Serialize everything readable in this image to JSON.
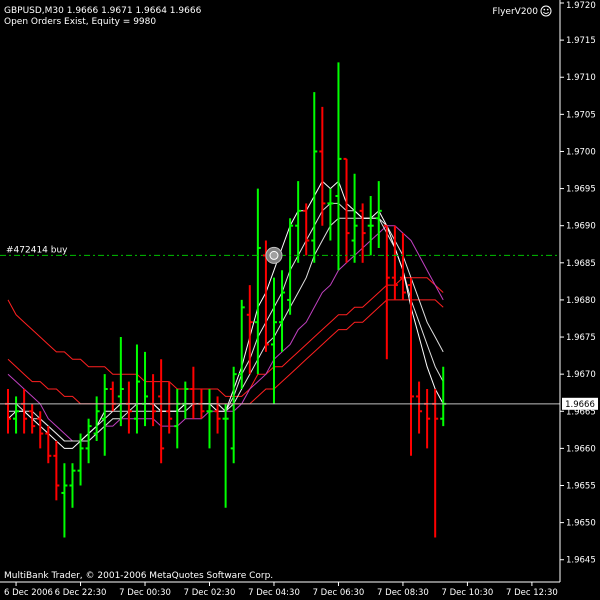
{
  "header": {
    "symbol_line": "GBPUSD,M30  1.9666 1.9671 1.9664 1.9666",
    "status_line": "Open Orders Exist, Equity = 9980",
    "indicator_name": "FlyerV200"
  },
  "footer": {
    "copyright": "MultiBank Trader, © 2001-2006 MetaQuotes Software Corp."
  },
  "order": {
    "label": "#472414 buy",
    "price": 1.9686,
    "color": "#00c000"
  },
  "current_price": {
    "label": "1.9666",
    "value": 1.9666
  },
  "colors": {
    "background": "#000000",
    "axis": "#ffffff",
    "bull_bar": "#00ff00",
    "bear_bar": "#ff0000",
    "ma_fast": "#ffffff",
    "ma_mid": "#e0e0e0",
    "ma_magenta": "#c040c0",
    "ma_red": "#ff2020"
  },
  "chart_data": {
    "type": "ohlc",
    "symbol": "GBPUSD",
    "timeframe": "M30",
    "ylim": [
      1.9642,
      1.972
    ],
    "y_ticks": [
      "1.9720",
      "1.9715",
      "1.9710",
      "1.9705",
      "1.9700",
      "1.9695",
      "1.9690",
      "1.9685",
      "1.9680",
      "1.9675",
      "1.9670",
      "1.9665",
      "1.9660",
      "1.9655",
      "1.9650",
      "1.9645"
    ],
    "x_ticks": [
      {
        "label": "6 Dec 2006",
        "bar": 1
      },
      {
        "label": "6 Dec 22:30",
        "bar": 9
      },
      {
        "label": "7 Dec 00:30",
        "bar": 17
      },
      {
        "label": "7 Dec 02:30",
        "bar": 25
      },
      {
        "label": "7 Dec 04:30",
        "bar": 33
      },
      {
        "label": "7 Dec 06:30",
        "bar": 41
      },
      {
        "label": "7 Dec 08:30",
        "bar": 49
      },
      {
        "label": "7 Dec 10:30",
        "bar": 57
      },
      {
        "label": "7 Dec 12:30",
        "bar": 65
      }
    ],
    "bars": [
      {
        "o": 1.9666,
        "h": 1.9668,
        "l": 1.9662,
        "c": 1.9664
      },
      {
        "o": 1.9664,
        "h": 1.9667,
        "l": 1.9662,
        "c": 1.9665
      },
      {
        "o": 1.9666,
        "h": 1.9668,
        "l": 1.9662,
        "c": 1.9664
      },
      {
        "o": 1.9665,
        "h": 1.9666,
        "l": 1.9662,
        "c": 1.9663
      },
      {
        "o": 1.9664,
        "h": 1.9665,
        "l": 1.966,
        "c": 1.9662
      },
      {
        "o": 1.9662,
        "h": 1.9663,
        "l": 1.9658,
        "c": 1.9659
      },
      {
        "o": 1.9659,
        "h": 1.9661,
        "l": 1.9653,
        "c": 1.9655
      },
      {
        "o": 1.9654,
        "h": 1.9658,
        "l": 1.9648,
        "c": 1.9655
      },
      {
        "o": 1.9655,
        "h": 1.9658,
        "l": 1.9652,
        "c": 1.9657
      },
      {
        "o": 1.9657,
        "h": 1.9662,
        "l": 1.9655,
        "c": 1.966
      },
      {
        "o": 1.966,
        "h": 1.9664,
        "l": 1.9658,
        "c": 1.9663
      },
      {
        "o": 1.9662,
        "h": 1.9667,
        "l": 1.9661,
        "c": 1.9665
      },
      {
        "o": 1.9664,
        "h": 1.967,
        "l": 1.9659,
        "c": 1.9668
      },
      {
        "o": 1.9668,
        "h": 1.9669,
        "l": 1.9665,
        "c": 1.9666
      },
      {
        "o": 1.9667,
        "h": 1.9675,
        "l": 1.9663,
        "c": 1.9668
      },
      {
        "o": 1.9666,
        "h": 1.9669,
        "l": 1.9662,
        "c": 1.9665
      },
      {
        "o": 1.9664,
        "h": 1.9674,
        "l": 1.9662,
        "c": 1.9669
      },
      {
        "o": 1.9666,
        "h": 1.9673,
        "l": 1.9663,
        "c": 1.9667
      },
      {
        "o": 1.9666,
        "h": 1.967,
        "l": 1.9663,
        "c": 1.9665
      },
      {
        "o": 1.9667,
        "h": 1.9672,
        "l": 1.9658,
        "c": 1.966
      },
      {
        "o": 1.9665,
        "h": 1.9669,
        "l": 1.9662,
        "c": 1.9664
      },
      {
        "o": 1.9663,
        "h": 1.9668,
        "l": 1.966,
        "c": 1.9666
      },
      {
        "o": 1.9666,
        "h": 1.9669,
        "l": 1.9664,
        "c": 1.9668
      },
      {
        "o": 1.9668,
        "h": 1.9671,
        "l": 1.9664,
        "c": 1.9666
      },
      {
        "o": 1.9666,
        "h": 1.9668,
        "l": 1.9664,
        "c": 1.9665
      },
      {
        "o": 1.9665,
        "h": 1.9668,
        "l": 1.966,
        "c": 1.9665
      },
      {
        "o": 1.9665,
        "h": 1.9667,
        "l": 1.9662,
        "c": 1.9664
      },
      {
        "o": 1.9664,
        "h": 1.9666,
        "l": 1.9652,
        "c": 1.9664
      },
      {
        "o": 1.966,
        "h": 1.9671,
        "l": 1.9658,
        "c": 1.967
      },
      {
        "o": 1.967,
        "h": 1.968,
        "l": 1.9668,
        "c": 1.9679
      },
      {
        "o": 1.9678,
        "h": 1.9682,
        "l": 1.967,
        "c": 1.9677
      },
      {
        "o": 1.9677,
        "h": 1.9695,
        "l": 1.967,
        "c": 1.9687
      },
      {
        "o": 1.9686,
        "h": 1.9688,
        "l": 1.9673,
        "c": 1.9674
      },
      {
        "o": 1.9674,
        "h": 1.9683,
        "l": 1.9666,
        "c": 1.9677
      },
      {
        "o": 1.9677,
        "h": 1.9684,
        "l": 1.9673,
        "c": 1.9681
      },
      {
        "o": 1.968,
        "h": 1.9691,
        "l": 1.9678,
        "c": 1.969
      },
      {
        "o": 1.969,
        "h": 1.9696,
        "l": 1.9685,
        "c": 1.9692
      },
      {
        "o": 1.9692,
        "h": 1.9693,
        "l": 1.9686,
        "c": 1.9688
      },
      {
        "o": 1.9688,
        "h": 1.9708,
        "l": 1.9685,
        "c": 1.97
      },
      {
        "o": 1.97,
        "h": 1.9706,
        "l": 1.969,
        "c": 1.9693
      },
      {
        "o": 1.9693,
        "h": 1.9695,
        "l": 1.9688,
        "c": 1.9693
      },
      {
        "o": 1.9694,
        "h": 1.9712,
        "l": 1.9684,
        "c": 1.9699
      },
      {
        "o": 1.9699,
        "h": 1.9699,
        "l": 1.9685,
        "c": 1.9689
      },
      {
        "o": 1.9688,
        "h": 1.9697,
        "l": 1.9685,
        "c": 1.969
      },
      {
        "o": 1.9692,
        "h": 1.9693,
        "l": 1.9685,
        "c": 1.9689
      },
      {
        "o": 1.969,
        "h": 1.9694,
        "l": 1.9686,
        "c": 1.969
      },
      {
        "o": 1.9691,
        "h": 1.9696,
        "l": 1.9687,
        "c": 1.9692
      },
      {
        "o": 1.969,
        "h": 1.969,
        "l": 1.9672,
        "c": 1.9683
      },
      {
        "o": 1.9683,
        "h": 1.969,
        "l": 1.968,
        "c": 1.9682
      },
      {
        "o": 1.9683,
        "h": 1.9689,
        "l": 1.968,
        "c": 1.9681
      },
      {
        "o": 1.9682,
        "h": 1.9683,
        "l": 1.9659,
        "c": 1.9667
      },
      {
        "o": 1.9667,
        "h": 1.9669,
        "l": 1.9662,
        "c": 1.9665
      },
      {
        "o": 1.9666,
        "h": 1.9668,
        "l": 1.966,
        "c": 1.9664
      },
      {
        "o": 1.9666,
        "h": 1.9668,
        "l": 1.9648,
        "c": 1.9664
      },
      {
        "o": 1.9664,
        "h": 1.9671,
        "l": 1.9663,
        "c": 1.9666
      }
    ],
    "series": [
      {
        "key": "ma_red_upper",
        "values": [
          1.968,
          1.9678,
          1.9677,
          1.9676,
          1.9675,
          1.9674,
          1.9673,
          1.9673,
          1.9672,
          1.9672,
          1.9671,
          1.9671,
          1.9671,
          1.967,
          1.967,
          1.967,
          1.967,
          1.9669,
          1.9669,
          1.9669,
          1.9669,
          1.9668,
          1.9668,
          1.9668,
          1.9668,
          1.9668,
          1.9668,
          1.9667,
          1.9667,
          1.9667,
          1.9668,
          1.967,
          1.967,
          1.9671,
          1.9671,
          1.9672,
          1.9673,
          1.9674,
          1.9675,
          1.9676,
          1.9677,
          1.9678,
          1.9678,
          1.9679,
          1.9679,
          1.968,
          1.9681,
          1.9682,
          1.9682,
          1.9683,
          1.9683,
          1.9683,
          1.9683,
          1.9682,
          1.9681
        ]
      },
      {
        "key": "ma_red_lower",
        "values": [
          1.9672,
          1.9671,
          1.967,
          1.9669,
          1.9669,
          1.9668,
          1.9668,
          1.9667,
          1.9667,
          1.9666,
          1.9666,
          1.9666,
          1.9666,
          1.9666,
          1.9666,
          1.9666,
          1.9666,
          1.9666,
          1.9666,
          1.9666,
          1.9666,
          1.9666,
          1.9666,
          1.9666,
          1.9666,
          1.9666,
          1.9666,
          1.9666,
          1.9666,
          1.9666,
          1.9666,
          1.9667,
          1.9668,
          1.9668,
          1.9669,
          1.967,
          1.9671,
          1.9672,
          1.9673,
          1.9674,
          1.9675,
          1.9676,
          1.9676,
          1.9677,
          1.9677,
          1.9678,
          1.9679,
          1.968,
          1.968,
          1.968,
          1.968,
          1.968,
          1.968,
          1.968,
          1.9679
        ]
      },
      {
        "key": "ma_magenta",
        "values": [
          1.967,
          1.9669,
          1.9668,
          1.9667,
          1.9666,
          1.9664,
          1.9663,
          1.9662,
          1.9661,
          1.9661,
          1.9661,
          1.9662,
          1.9663,
          1.9663,
          1.9664,
          1.9664,
          1.9664,
          1.9664,
          1.9664,
          1.9663,
          1.9663,
          1.9663,
          1.9664,
          1.9664,
          1.9664,
          1.9665,
          1.9665,
          1.9665,
          1.9665,
          1.9666,
          1.9668,
          1.9669,
          1.967,
          1.9672,
          1.9673,
          1.9674,
          1.9676,
          1.9677,
          1.9679,
          1.9681,
          1.9682,
          1.9684,
          1.9685,
          1.9686,
          1.9687,
          1.9688,
          1.9689,
          1.969,
          1.969,
          1.9689,
          1.9688,
          1.9686,
          1.9684,
          1.9682,
          1.968
        ]
      },
      {
        "key": "ma_white_slow",
        "values": [
          1.9666,
          1.9666,
          1.9665,
          1.9665,
          1.9664,
          1.9663,
          1.9662,
          1.9661,
          1.9661,
          1.9661,
          1.9661,
          1.9662,
          1.9663,
          1.9664,
          1.9664,
          1.9665,
          1.9665,
          1.9665,
          1.9665,
          1.9665,
          1.9665,
          1.9665,
          1.9665,
          1.9666,
          1.9666,
          1.9666,
          1.9666,
          1.9665,
          1.9666,
          1.9668,
          1.967,
          1.9672,
          1.9674,
          1.9675,
          1.9677,
          1.9679,
          1.9681,
          1.9683,
          1.9686,
          1.9688,
          1.969,
          1.9691,
          1.9691,
          1.9691,
          1.9691,
          1.9691,
          1.9691,
          1.969,
          1.9688,
          1.9686,
          1.9683,
          1.968,
          1.9677,
          1.9675,
          1.9673
        ]
      },
      {
        "key": "ma_white_mid",
        "values": [
          1.9665,
          1.9665,
          1.9665,
          1.9664,
          1.9664,
          1.9663,
          1.9662,
          1.9661,
          1.9661,
          1.9661,
          1.9662,
          1.9663,
          1.9664,
          1.9665,
          1.9665,
          1.9665,
          1.9666,
          1.9666,
          1.9666,
          1.9665,
          1.9665,
          1.9665,
          1.9666,
          1.9666,
          1.9666,
          1.9666,
          1.9666,
          1.9665,
          1.9667,
          1.967,
          1.9672,
          1.9675,
          1.9677,
          1.9679,
          1.9681,
          1.9684,
          1.9686,
          1.9688,
          1.969,
          1.9692,
          1.9693,
          1.9693,
          1.9692,
          1.9692,
          1.9691,
          1.9691,
          1.9691,
          1.9689,
          1.9687,
          1.9684,
          1.968,
          1.9677,
          1.9674,
          1.9671,
          1.9669
        ]
      },
      {
        "key": "ma_white_fast",
        "values": [
          1.9664,
          1.9665,
          1.9665,
          1.9664,
          1.9663,
          1.9662,
          1.9661,
          1.966,
          1.966,
          1.9661,
          1.9662,
          1.9663,
          1.9665,
          1.9665,
          1.9666,
          1.9666,
          1.9666,
          1.9666,
          1.9666,
          1.9665,
          1.9665,
          1.9665,
          1.9666,
          1.9666,
          1.9666,
          1.9666,
          1.9665,
          1.9665,
          1.9668,
          1.9671,
          1.9675,
          1.9679,
          1.9681,
          1.9684,
          1.9687,
          1.969,
          1.9692,
          1.9692,
          1.9694,
          1.9696,
          1.9695,
          1.9696,
          1.9693,
          1.9692,
          1.9691,
          1.9691,
          1.9692,
          1.969,
          1.9687,
          1.9684,
          1.9679,
          1.9675,
          1.9671,
          1.9668,
          1.9666
        ]
      }
    ]
  }
}
